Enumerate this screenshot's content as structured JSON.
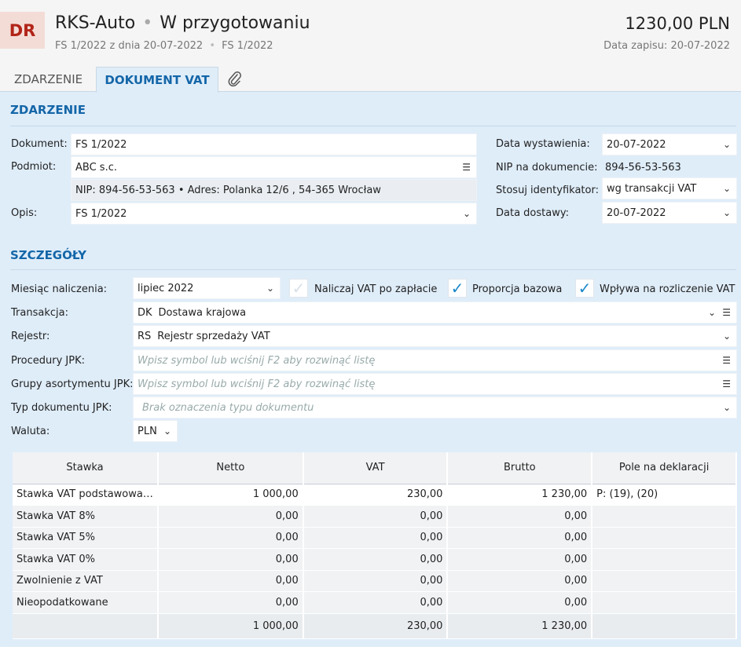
{
  "header": {
    "badge": "DR",
    "company": "RKS-Auto",
    "separator": "•",
    "status": "W przygotowaniu",
    "sub_doc": "FS 1/2022 z dnia 20-07-2022",
    "sub_ref": "FS 1/2022",
    "amount": "1230,00 PLN",
    "saved": "Data zapisu: 20-07-2022"
  },
  "tabs": {
    "event": "ZDARZENIE",
    "vat": "DOKUMENT VAT",
    "attachment_icon": "paperclip-icon"
  },
  "event": {
    "section_title": "ZDARZENIE",
    "document_label": "Dokument:",
    "document_value": "FS 1/2022",
    "subject_label": "Podmiot:",
    "subject_value": "ABC s.c.",
    "nip_info": "NIP:  894-56-53-563  •  Adres:  Polanka  12/6 , 54-365 Wrocław",
    "desc_label": "Opis:",
    "desc_value": "FS 1/2022",
    "issue_date_label": "Data wystawienia:",
    "issue_date_value": "20-07-2022",
    "nip_doc_label": "NIP na dokumencie:",
    "nip_doc_value": "894-56-53-563",
    "identifier_label": "Stosuj identyfikator:",
    "identifier_value": "wg transakcji VAT",
    "delivery_date_label": "Data dostawy:",
    "delivery_date_value": "20-07-2022"
  },
  "details": {
    "section_title": "SZCZEGÓŁY",
    "month_label": "Miesiąc naliczenia:",
    "month_value": "lipiec 2022",
    "vat_on_payment_label": "Naliczaj VAT po zapłacie",
    "vat_on_payment_checked": false,
    "base_ratio_label": "Proporcja bazowa",
    "base_ratio_checked": true,
    "affects_label": "Wpływa na rozliczenie VAT",
    "affects_checked": true,
    "transaction_label": "Transakcja:",
    "transaction_code": "DK",
    "transaction_name": "Dostawa krajowa",
    "register_label": "Rejestr:",
    "register_code": "RS",
    "register_name": "Rejestr sprzedaży VAT",
    "jpk_proc_label": "Procedury JPK:",
    "jpk_proc_placeholder": "Wpisz symbol lub wciśnij F2 aby rozwinąć listę",
    "jpk_groups_label": "Grupy asortymentu JPK:",
    "jpk_groups_placeholder": "Wpisz symbol lub wciśnij F2 aby rozwinąć listę",
    "jpk_type_label": "Typ dokumentu JPK:",
    "jpk_type_placeholder": "Brak oznaczenia typu dokumentu",
    "currency_label": "Waluta:",
    "currency_value": "PLN"
  },
  "vat_table": {
    "headers": [
      "Stawka",
      "Netto",
      "VAT",
      "Brutto",
      "Pole na deklaracji"
    ],
    "rows": [
      [
        "Stawka VAT podstawowa…",
        "1 000,00",
        "230,00",
        "1 230,00",
        "P: (19), (20)"
      ],
      [
        "Stawka VAT 8%",
        "0,00",
        "0,00",
        "0,00",
        ""
      ],
      [
        "Stawka VAT 5%",
        "0,00",
        "0,00",
        "0,00",
        ""
      ],
      [
        "Stawka VAT 0%",
        "0,00",
        "0,00",
        "0,00",
        ""
      ],
      [
        "Zwolnienie z VAT",
        "0,00",
        "0,00",
        "0,00",
        ""
      ],
      [
        "Nieopodatkowane",
        "0,00",
        "0,00",
        "0,00",
        ""
      ]
    ],
    "totals": [
      "",
      "1 000,00",
      "230,00",
      "1 230,00",
      ""
    ]
  }
}
